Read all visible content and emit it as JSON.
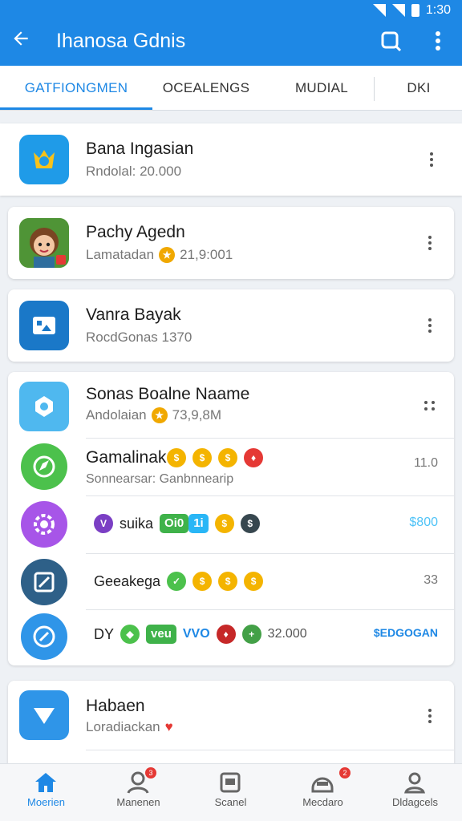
{
  "status_bar": {
    "time": "1:30"
  },
  "app_bar": {
    "title": "Ihanosa Gdnis",
    "back_icon": "arrow-left-icon",
    "search_icon": "search-icon",
    "menu_icon": "more-vert-icon"
  },
  "tabs": [
    {
      "label": "GATFIONGMEN",
      "active": true
    },
    {
      "label": "OCEALENGS",
      "active": false
    },
    {
      "label": "MUDIAL",
      "active": false
    },
    {
      "label": "DKI",
      "active": false
    }
  ],
  "games": [
    {
      "name": "Bana Ingasian",
      "subtitle": "Rndolal: 20.000",
      "icon": "crown-icon",
      "color": "#1f9be8"
    },
    {
      "name": "Pachy Agedn",
      "subtitle": "Lamatadan",
      "value": "21,9:001",
      "icon": "character-avatar-icon"
    },
    {
      "name": "Vanra Bayak",
      "subtitle": "RocdGonas 1370",
      "icon": "gallery-icon",
      "color": "#1a78c8"
    },
    {
      "name": "Sonas Boalne Naame",
      "subtitle": "Andolaian",
      "value": "73,9,8M",
      "icon": "puzzle-icon",
      "color": "#4fb8ef"
    },
    {
      "name": "Gamalinak",
      "subtitle": "Sonnearsar: Ganbnnearip",
      "amount": "11.0",
      "icon": "compass-check-icon",
      "color": "#4cc14c"
    },
    {
      "name": "suika",
      "pill": "Oi0",
      "pill2": "1i",
      "amount": "$800",
      "icon": "flower-icon",
      "color": "#a755e8"
    },
    {
      "name": "Geeakega",
      "amount": "33",
      "icon": "edit-box-icon",
      "color": "#2e6088"
    },
    {
      "name": "DY",
      "pill": "veu",
      "mid": "VVO",
      "value": "32.000",
      "amount": "$EDGOGAN",
      "icon": "compass-icon",
      "color": "#2f95e8"
    },
    {
      "name": "Habaen",
      "subtitle": "Loradiackan",
      "icon": "paper-plane-icon",
      "color": "#2f95e8"
    }
  ],
  "bottom_nav": [
    {
      "label": "Moerien",
      "icon": "home-icon",
      "active": true
    },
    {
      "label": "Manenen",
      "icon": "people-icon",
      "badge": "3"
    },
    {
      "label": "Scanel",
      "icon": "storage-icon"
    },
    {
      "label": "Mecdaro",
      "icon": "helmet-icon",
      "badge": "2"
    },
    {
      "label": "Dldagcels",
      "icon": "profile-icon"
    }
  ],
  "colors": {
    "primary": "#1e88e5",
    "amount_blue": "#1e88e5",
    "amount_cyan": "#4fc3f7"
  }
}
